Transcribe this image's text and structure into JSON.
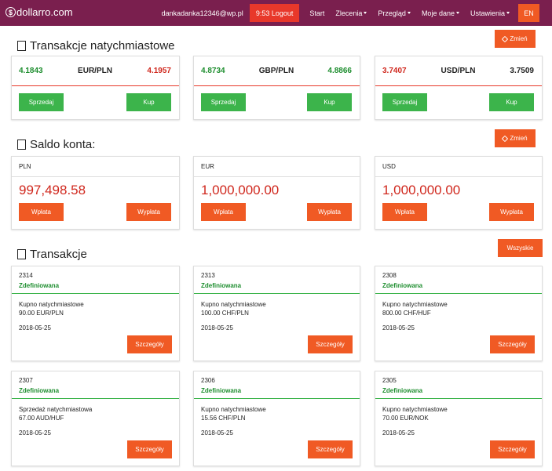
{
  "brand": {
    "name": "dollarro.com"
  },
  "nav": {
    "email": "dankadanka12346@wp.pl",
    "logout": "9:53 Logout",
    "items": [
      "Start",
      "Zlecenia",
      "Przegląd",
      "Moje dane",
      "Ustawienia"
    ],
    "lang": "EN"
  },
  "instant": {
    "title": "Transakcje natychmiastowe",
    "change_label": "Zmień",
    "cards": [
      {
        "bid": "4.1843",
        "pair": "EUR/PLN",
        "ask": "4.1957",
        "sell": "Sprzedaj",
        "buy": "Kup"
      },
      {
        "bid": "4.8734",
        "pair": "GBP/PLN",
        "ask": "4.8866",
        "sell": "Sprzedaj",
        "buy": "Kup"
      },
      {
        "bid": "3.7407",
        "pair": "USD/PLN",
        "ask": "3.7509",
        "sell": "Sprzedaj",
        "buy": "Kup"
      }
    ]
  },
  "balance": {
    "title": "Saldo konta:",
    "change_label": "Zmień",
    "cards": [
      {
        "currency": "PLN",
        "amount": "997,498.58",
        "deposit": "Wpłata",
        "withdraw": "Wypłata"
      },
      {
        "currency": "EUR",
        "amount": "1,000,000.00",
        "deposit": "Wpłata",
        "withdraw": "Wypłata"
      },
      {
        "currency": "USD",
        "amount": "1,000,000.00",
        "deposit": "Wpłata",
        "withdraw": "Wypłata"
      }
    ]
  },
  "transactions": {
    "title": "Transakcje",
    "all_label": "Wszyskie",
    "items": [
      {
        "id": "2314",
        "status": "Zdefiniowana",
        "type": "Kupno natychmiastowe",
        "amount": "90.00 EUR/PLN",
        "date": "2018-05-25",
        "details": "Szczegóły"
      },
      {
        "id": "2313",
        "status": "Zdefiniowana",
        "type": "Kupno natychmiastowe",
        "amount": "100.00 CHF/PLN",
        "date": "2018-05-25",
        "details": "Szczegóły"
      },
      {
        "id": "2308",
        "status": "Zdefiniowana",
        "type": "Kupno natychmiastowe",
        "amount": "800.00 CHF/HUF",
        "date": "2018-05-25",
        "details": "Szczegóły"
      },
      {
        "id": "2307",
        "status": "Zdefiniowana",
        "type": "Sprzedaż natychmiastowa",
        "amount": "67.00 AUD/HUF",
        "date": "2018-05-25",
        "details": "Szczegóły"
      },
      {
        "id": "2306",
        "status": "Zdefiniowana",
        "type": "Kupno natychmiastowe",
        "amount": "15.56 CHF/PLN",
        "date": "2018-05-25",
        "details": "Szczegóły"
      },
      {
        "id": "2305",
        "status": "Zdefiniowana",
        "type": "Kupno natychmiastowe",
        "amount": "70.00 EUR/NOK",
        "date": "2018-05-25",
        "details": "Szczegóły"
      }
    ]
  },
  "colors": {
    "navbar": "#7a1f4e",
    "accent_orange": "#f05a24",
    "green": "#3cb44b",
    "red": "#d0281e"
  }
}
